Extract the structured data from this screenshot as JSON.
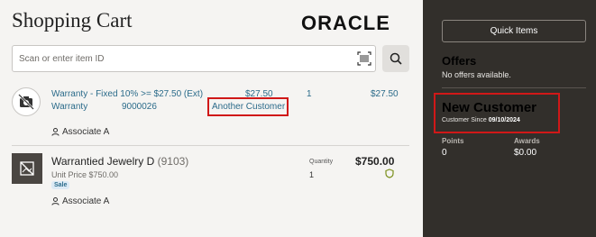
{
  "header": {
    "title": "Shopping Cart",
    "brand": "ORACLE"
  },
  "search": {
    "placeholder": "Scan or enter item ID"
  },
  "warranty_row": {
    "line1": "Warranty - Fixed 10% >= $27.50 (Ext)",
    "line1_price": "$27.50",
    "line1_qty": "1",
    "line1_total": "$27.50",
    "line2": "Warranty",
    "line2_code": "9000026",
    "customer_link": "Another Customer",
    "associate": "Associate A"
  },
  "product_row": {
    "name": "Warrantied Jewelry D",
    "sku": "(9103)",
    "unit_price": "Unit Price $750.00",
    "badge": "Sale",
    "quantity_label": "Quantity",
    "quantity": "1",
    "price": "$750.00",
    "associate": "Associate A"
  },
  "sidebar": {
    "quick_items": "Quick Items",
    "offers_title": "Offers",
    "offers_sub": "No offers available.",
    "customer_name": "New Customer",
    "customer_since_label": "Customer Since",
    "customer_since_date": "09/10/2024",
    "points_label": "Points",
    "points_value": "0",
    "awards_label": "Awards",
    "awards_value": "$0.00"
  },
  "colors": {
    "accent_link": "#2b6b8a",
    "highlight": "#d01818",
    "sidebar_bg": "#322f2b"
  }
}
